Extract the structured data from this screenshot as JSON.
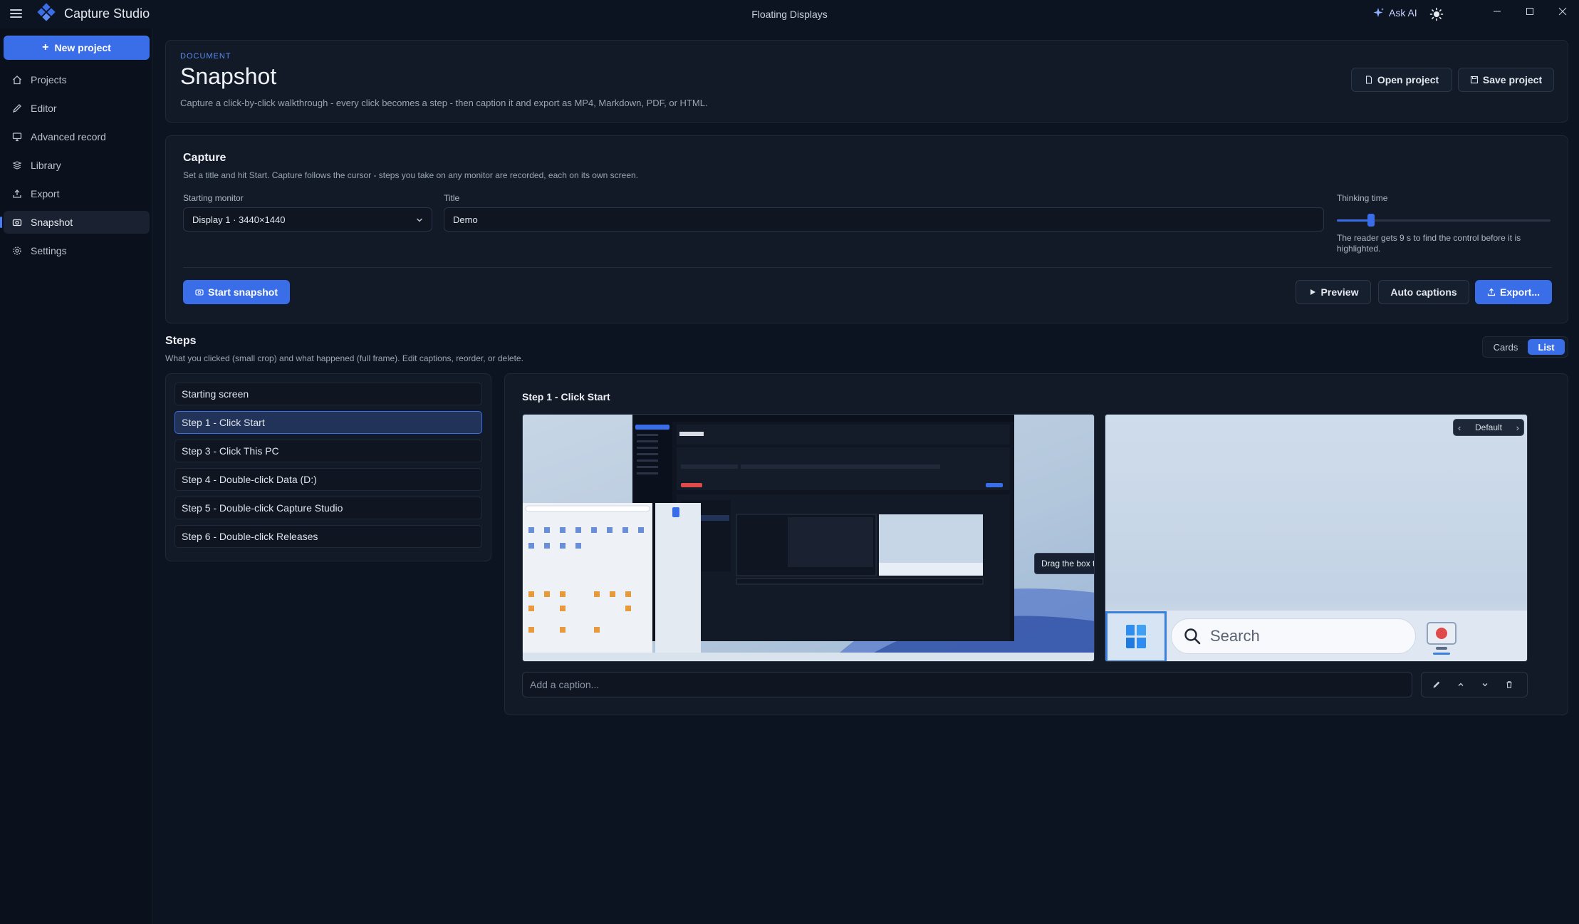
{
  "app": {
    "name": "Capture Studio",
    "window_title": "Floating Displays",
    "ask_ai_label": "Ask AI",
    "accent_color": "#3a6ee8"
  },
  "sidebar": {
    "new_project_label": "New project",
    "items": [
      {
        "label": "Projects",
        "icon": "home-icon"
      },
      {
        "label": "Editor",
        "icon": "pencil-icon"
      },
      {
        "label": "Advanced record",
        "icon": "monitor-icon"
      },
      {
        "label": "Library",
        "icon": "library-icon"
      },
      {
        "label": "Export",
        "icon": "upload-icon"
      },
      {
        "label": "Snapshot",
        "icon": "camera-icon",
        "active": true
      },
      {
        "label": "Settings",
        "icon": "gear-icon"
      }
    ]
  },
  "header": {
    "eyebrow": "DOCUMENT",
    "title": "Snapshot",
    "description": "Capture a click-by-click walkthrough - every click becomes a step - then caption it and export as MP4, Markdown, PDF, or HTML.",
    "open_project_label": "Open project",
    "save_project_label": "Save project"
  },
  "capture": {
    "title": "Capture",
    "description": "Set a title and hit Start. Capture follows the cursor - steps you take on any monitor are recorded, each on its own screen.",
    "monitor_label": "Starting monitor",
    "monitor_value": "Display 1 · 3440×1440",
    "title_label": "Title",
    "title_value": "Demo",
    "thinking_label": "Thinking time",
    "thinking_fraction": 0.16,
    "thinking_help": "The reader gets 9 s to find the control before it is highlighted.",
    "start_label": "Start snapshot",
    "preview_label": "Preview",
    "auto_captions_label": "Auto captions",
    "export_label": "Export..."
  },
  "steps": {
    "title": "Steps",
    "description": "What you clicked (small crop) and what happened (full frame). Edit captions, reorder, or delete.",
    "view_cards_label": "Cards",
    "view_list_label": "List",
    "items": [
      {
        "label": "Starting screen"
      },
      {
        "label": "Step 1 - Click Start",
        "active": true
      },
      {
        "label": "Step 3 - Click This PC"
      },
      {
        "label": "Step 4 - Double-click Data (D:)"
      },
      {
        "label": "Step 5 - Double-click Capture Studio"
      },
      {
        "label": "Step 6 - Double-click Releases"
      }
    ]
  },
  "detail": {
    "title": "Step 1 - Click Start",
    "tooltip": "Drag the box to move it, or a corner to resize",
    "crop_nav_label": "Default",
    "crop_search_label": "Search",
    "caption_placeholder": "Add a caption..."
  }
}
